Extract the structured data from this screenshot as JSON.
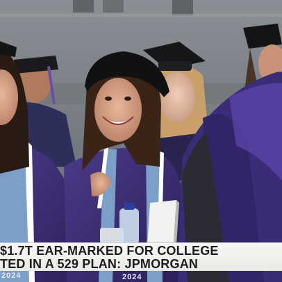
{
  "caption": {
    "line1": "$1.7T EAR-MARKED FOR COLLEGE",
    "line2": "TED IN A 529 PLAN: JPMORGAN"
  },
  "stole_text": {
    "left": "2024",
    "center": "2024"
  },
  "colors": {
    "gown_purple": "#3a2a6e",
    "gown_navy": "#1d2340",
    "hood_blue": "#7c9fc8",
    "caption_bg": "#f4f4f2",
    "caption_text": "#1c1c1c"
  },
  "icons": [
    "mortarboard-cap",
    "water-bottle",
    "smartphone",
    "book"
  ]
}
